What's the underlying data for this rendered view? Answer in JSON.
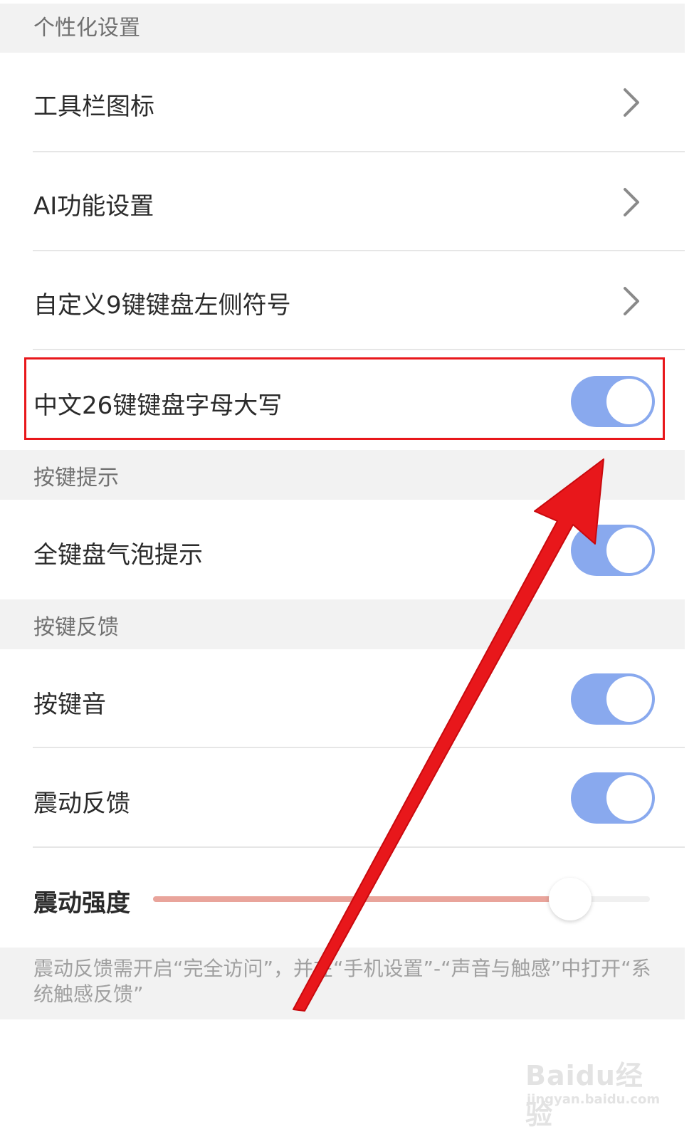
{
  "sections": {
    "personalization": {
      "title": "个性化设置"
    },
    "key_hints": {
      "title": "按键提示"
    },
    "key_feedback": {
      "title": "按键反馈"
    }
  },
  "rows": {
    "toolbar_icons": {
      "label": "工具栏图标"
    },
    "ai_settings": {
      "label": "AI功能设置"
    },
    "custom_9key_symbols": {
      "label": "自定义9键键盘左侧符号"
    },
    "chinese_26key_uppercase": {
      "label": "中文26键键盘字母大写",
      "enabled": true
    },
    "bubble_hint": {
      "label": "全键盘气泡提示",
      "enabled": true
    },
    "key_sound": {
      "label": "按键音",
      "enabled": true
    },
    "vibration_feedback": {
      "label": "震动反馈",
      "enabled": true
    },
    "vibration_strength": {
      "label": "震动强度",
      "value_fraction": 0.84
    }
  },
  "footer_note": "震动反馈需开启“完全访问”，并在“手机设置”-“声音与触感”中打开“系统触感反馈”",
  "watermark": {
    "main": "Baidu经验",
    "sub": "jingyan.baidu.com"
  },
  "colors": {
    "toggle_on": "#89a9ee",
    "slider_fill": "#e9a49b",
    "annotation_red": "#e8171b",
    "section_bg": "#f2f2f2"
  },
  "icons": {
    "row_chevron": "chevron-right-icon"
  }
}
